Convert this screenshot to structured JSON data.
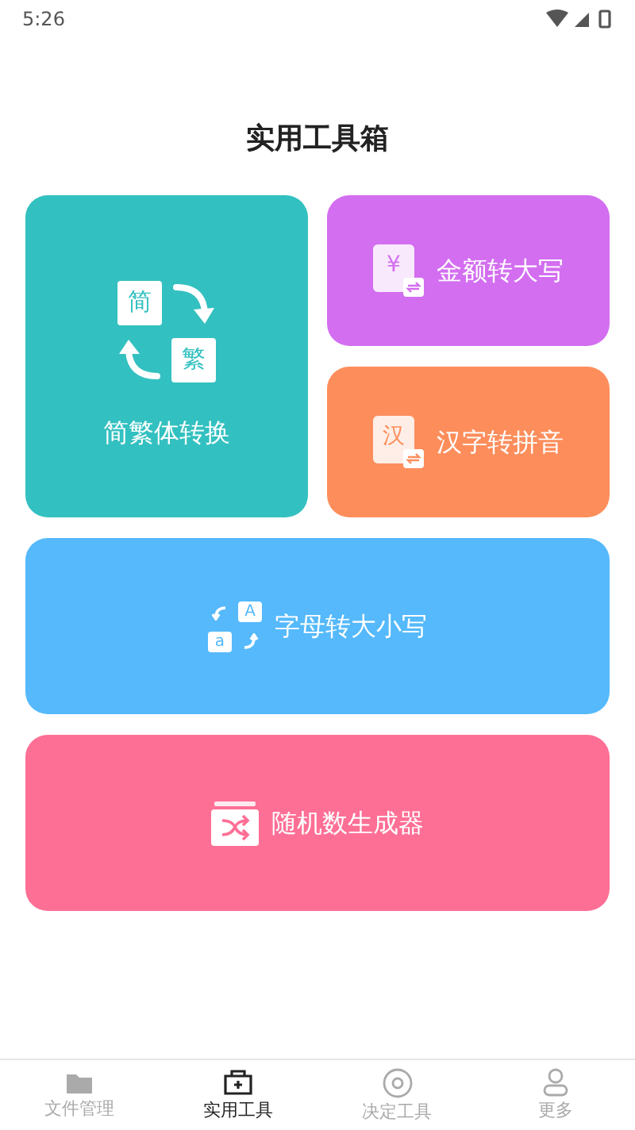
{
  "status_bar": {
    "time": "5:26"
  },
  "title": "实用工具箱",
  "tiles": [
    {
      "kind": "convert",
      "label": "简繁体转换",
      "color": "#33c0c0",
      "icon_texts": [
        "简",
        "繁"
      ]
    },
    {
      "kind": "money",
      "label": "金额转大写",
      "color": "#d36ef0",
      "icon_texts": [
        "¥"
      ]
    },
    {
      "kind": "pinyin",
      "label": "汉字转拼音",
      "color": "#fd8e5c",
      "icon_texts": [
        "汉"
      ]
    },
    {
      "kind": "letters",
      "label": "字母转大小写",
      "color": "#55b9fb",
      "icon_texts": [
        "A",
        "a"
      ]
    },
    {
      "kind": "random",
      "label": "随机数生成器",
      "color": "#fe6f95"
    }
  ],
  "nav": [
    {
      "kind": "folder",
      "label": "文件管理",
      "selected": false
    },
    {
      "kind": "toolbox",
      "label": "实用工具",
      "selected": true
    },
    {
      "kind": "target",
      "label": "决定工具",
      "selected": false
    },
    {
      "kind": "person",
      "label": "更多",
      "selected": false
    }
  ]
}
